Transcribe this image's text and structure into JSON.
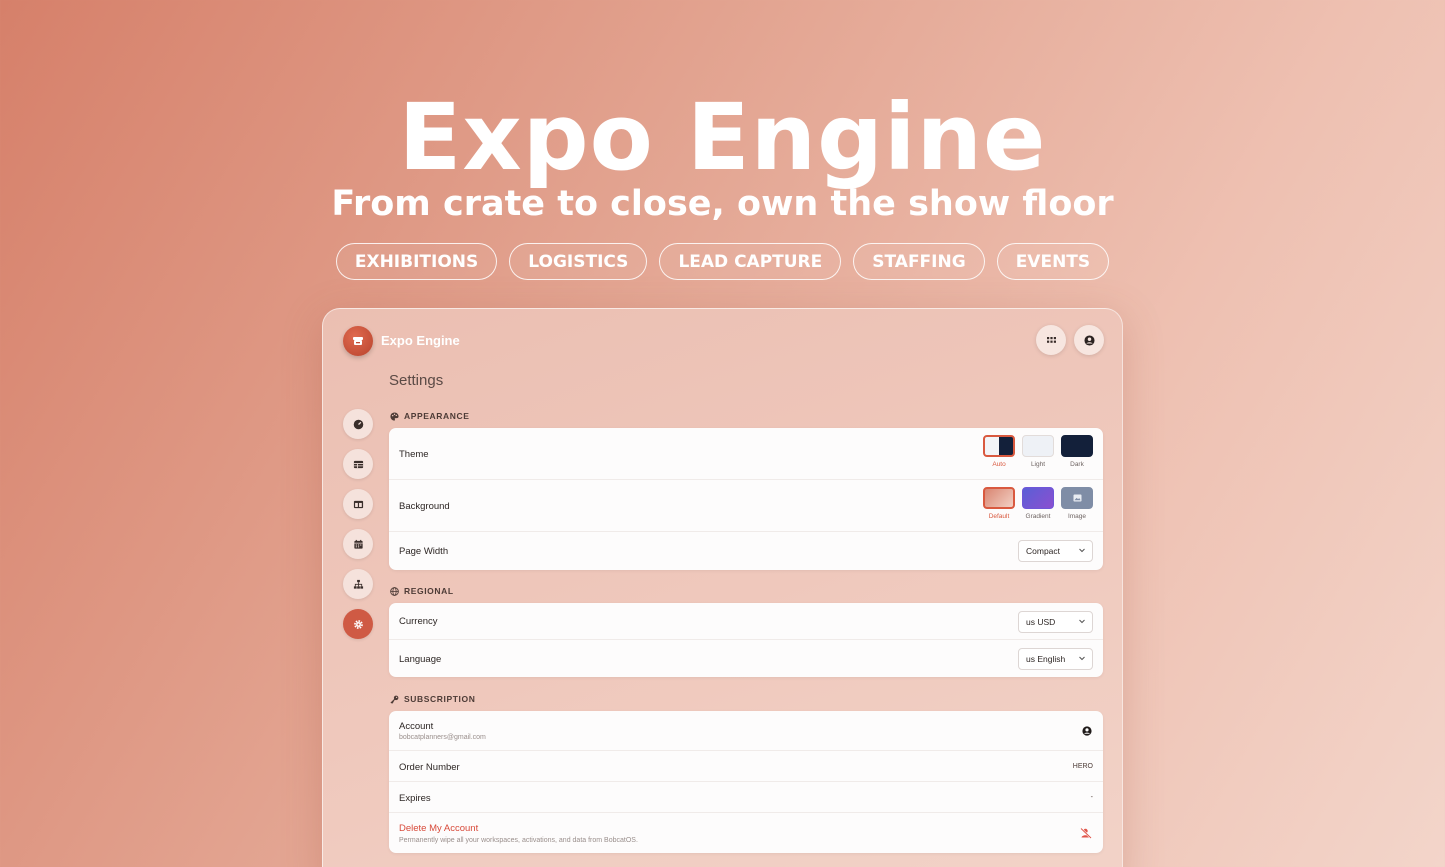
{
  "hero": {
    "title": "Expo Engine",
    "subtitle": "From crate to close, own the show floor",
    "chips": [
      "EXHIBITIONS",
      "LOGISTICS",
      "LEAD CAPTURE",
      "STAFFING",
      "EVENTS"
    ]
  },
  "app": {
    "name": "Expo Engine",
    "page_title": "Settings"
  },
  "nav": {
    "items": [
      "dashboard-icon",
      "table-icon",
      "layout-icon",
      "calendar-icon",
      "sitemap-icon",
      "settings-icon"
    ],
    "active": "settings-icon"
  },
  "appearance": {
    "heading": "APPEARANCE",
    "theme_label": "Theme",
    "theme_options": [
      "Auto",
      "Light",
      "Dark"
    ],
    "theme_selected": "Auto",
    "background_label": "Background",
    "background_options": [
      "Default",
      "Gradient",
      "Image"
    ],
    "background_selected": "Default",
    "page_width_label": "Page Width",
    "page_width_value": "Compact"
  },
  "regional": {
    "heading": "REGIONAL",
    "currency_label": "Currency",
    "currency_value": "us USD",
    "language_label": "Language",
    "language_value": "us English"
  },
  "subscription": {
    "heading": "SUBSCRIPTION",
    "account_label": "Account",
    "account_email": "bobcatplanners@gmail.com",
    "order_label": "Order Number",
    "order_value": "HERO",
    "expires_label": "Expires",
    "expires_value": "-",
    "delete_label": "Delete My Account",
    "delete_desc": "Permanently wipe all your workspaces, activations, and data from BobcatOS."
  },
  "colors": {
    "accent": "#cf5a44",
    "danger": "#d84a3a",
    "dark_swatch": "#13203a",
    "gradient_swatch": "#6f56d8"
  }
}
